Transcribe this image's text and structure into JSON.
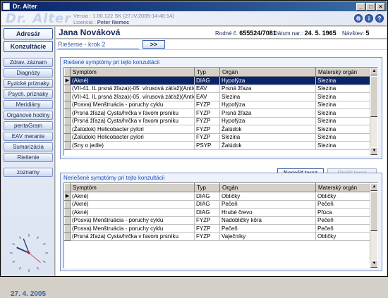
{
  "window": {
    "title": "Dr. Alter"
  },
  "header": {
    "logo": "Dr. Alter",
    "version_label": "Verzia :",
    "version_value": "1.00.122 SK (27.IV.2005-14:40:14)",
    "license_label": "Licencia :",
    "license_value": "Peter Nemec",
    "icons": [
      "settings-icon",
      "info-icon",
      "help-icon"
    ]
  },
  "sidebar": {
    "main_buttons": [
      "Adresár",
      "Konzultácie"
    ],
    "items": [
      "Zdrav. záznam",
      "Diagnózy",
      "Fyzické príznaky",
      "Psych. príznaky",
      "Meridiány",
      "Orgánové hodiny",
      "pentaGram",
      "EAV meranie",
      "Sumarizácia",
      "Riešenie"
    ],
    "extra": "zoznamy",
    "date": "27. 4. 2005"
  },
  "patient": {
    "name": "Jana Nováková",
    "rc_label": "Rodné č.",
    "rc_value": "655524/7081",
    "dob_label": "Dátum nar.:",
    "dob_value": "24. 5. 1965",
    "visits_label": "Návštev:",
    "visits_value": "5"
  },
  "step": {
    "title": "Riešenie - krok 2",
    "next": ">>"
  },
  "solved": {
    "title": "Riešené symptómy pri tejto konzultácii",
    "columns": [
      "Symptóm",
      "Typ",
      "Orgán",
      "Materský orgán"
    ],
    "rows": [
      [
        "(Akné)",
        "DIAG",
        "Hypofýza",
        "Slezina"
      ],
      [
        "(VII-41. IL prsná žľaza)(-05. vírusová záťaž)(Antivir)",
        "EAV",
        "Prsná žľaza",
        "Slezina"
      ],
      [
        "(VII-41. IL prsná žľaza)(-05. vírusová záťaž)(Antivir)",
        "EAV",
        "Slezina",
        "Slezina"
      ],
      [
        "(Posva) Menštruácia - poruchy cyklu",
        "FYZP",
        "Hypofýza",
        "Slezina"
      ],
      [
        "(Prsná žľaza) Cysta/hrčka v ľavom prsníku",
        "FYZP",
        "Prsná žľaza",
        "Slezina"
      ],
      [
        "(Prsná žľaza) Cysta/hrčka v ľavom prsníku",
        "FYZP",
        "Hypofýza",
        "Slezina"
      ],
      [
        "(Žalúdok) Helicobacter pylori",
        "FYZP",
        "Žalúdok",
        "Slezina"
      ],
      [
        "(Žalúdok) Helicobacter pylori",
        "FYZP",
        "Slezina",
        "Slezina"
      ],
      [
        "(Sny o jedle)",
        "PSYP",
        "Žalúdok",
        "Slezina"
      ]
    ]
  },
  "actions": {
    "unsolve": "Neriešiť teraz",
    "solve": "Riešiť teraz"
  },
  "unsolved": {
    "title": "Neriešené symptómy pri tejto konzultácii",
    "columns": [
      "Symptóm",
      "Typ",
      "Orgán",
      "Materský orgán"
    ],
    "rows": [
      [
        "(Akné)",
        "DIAG",
        "Obličky",
        "Obličky"
      ],
      [
        "(Akné)",
        "DIAG",
        "Pečeň",
        "Pečeň"
      ],
      [
        "(Akné)",
        "DIAG",
        "Hrubé črevo",
        "Pľúca"
      ],
      [
        "(Posva) Menštruácia - poruchy cyklu",
        "FYZP",
        "Nadobličky kôra",
        "Pečeň"
      ],
      [
        "(Posva) Menštruácia - poruchy cyklu",
        "FYZP",
        "Pečeň",
        "Pečeň"
      ],
      [
        "(Prsná žľaza) Cysta/hrčka v ľavom prsníku",
        "FYZP",
        "Vaječníky",
        "Obličky"
      ]
    ]
  }
}
